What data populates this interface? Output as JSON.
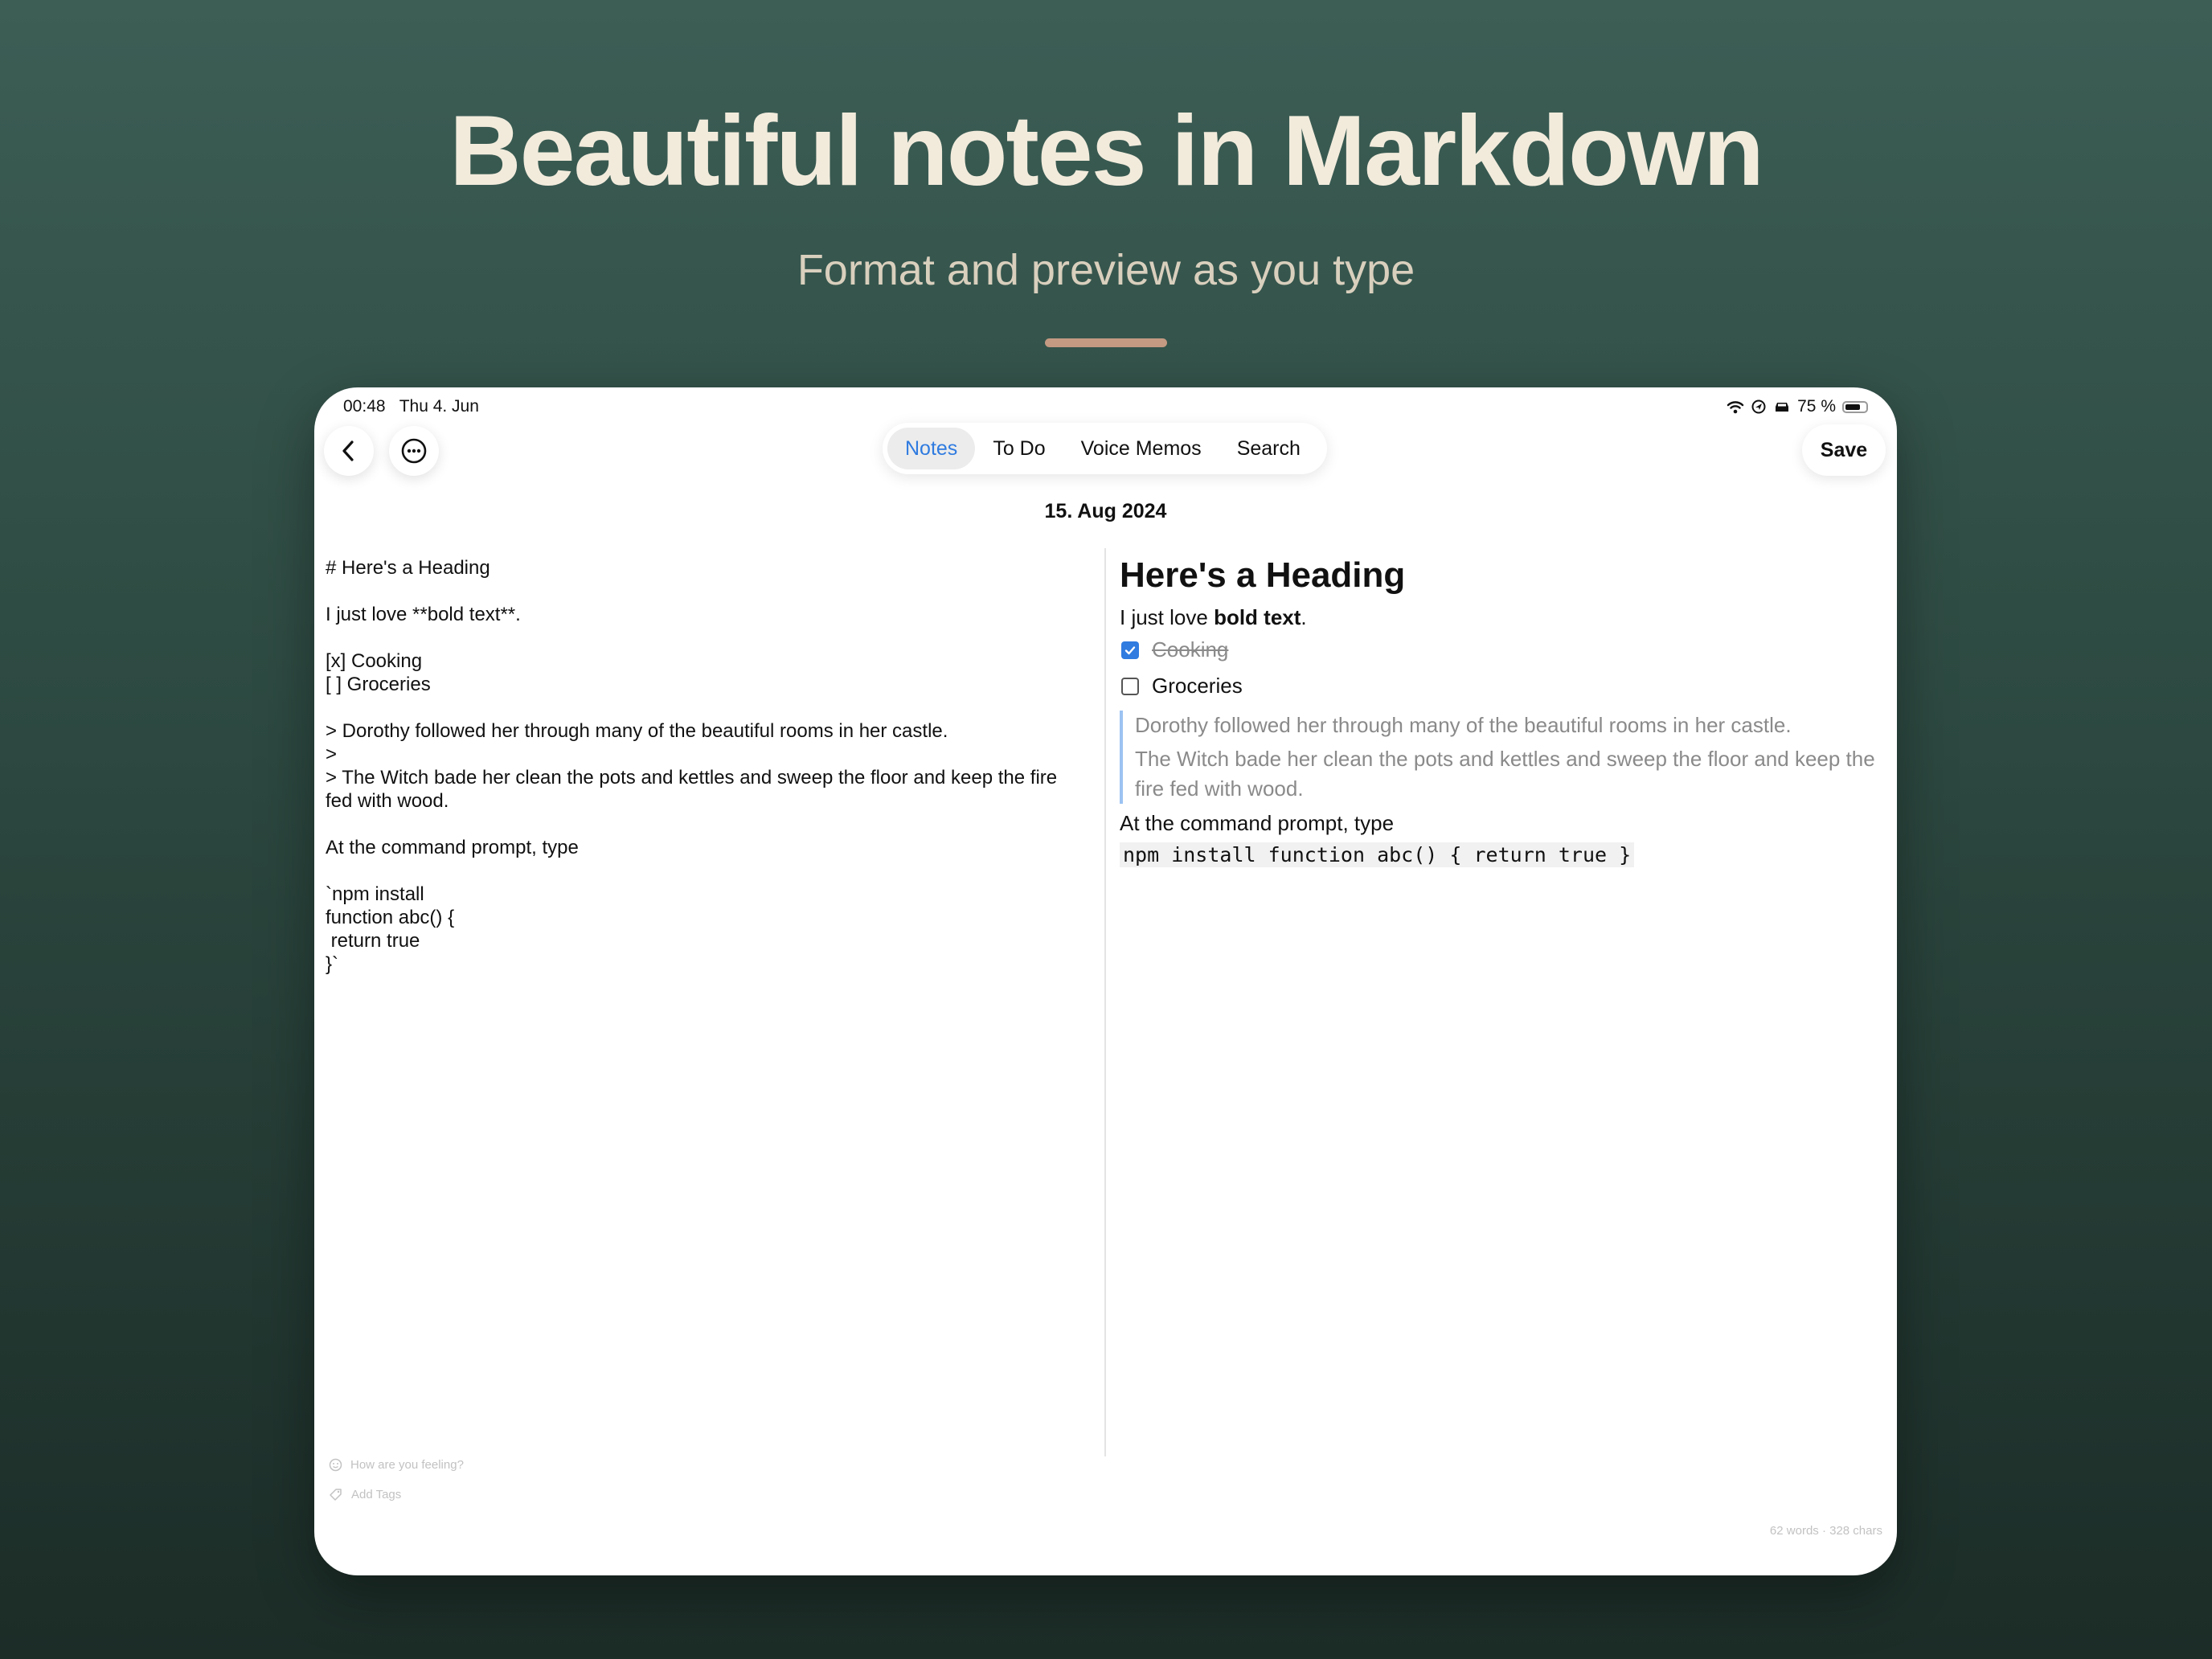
{
  "promo": {
    "headline": "Beautiful notes in Markdown",
    "subheadline": "Format and preview as you type"
  },
  "status_bar": {
    "time": "00:48",
    "date": "Thu 4. Jun",
    "battery": "75 %",
    "battery_level": 0.75
  },
  "toolbar": {
    "tabs": [
      {
        "label": "Notes",
        "active": true
      },
      {
        "label": "To Do",
        "active": false
      },
      {
        "label": "Voice Memos",
        "active": false
      },
      {
        "label": "Search",
        "active": false
      }
    ],
    "save_label": "Save"
  },
  "note": {
    "date": "15. Aug 2024",
    "source_lines": [
      "# Here's a Heading",
      "",
      "I just love **bold text**.",
      "",
      "[x] Cooking",
      "[ ] Groceries",
      "",
      "> Dorothy followed her through many of the beautiful rooms in her castle.",
      ">",
      "> The Witch bade her clean the pots and kettles and sweep the floor and keep the fire",
      "fed with wood.",
      "",
      "At the command prompt, type",
      "",
      "`npm install",
      "function abc() {",
      " return true",
      "}`"
    ],
    "preview": {
      "heading": "Here's a Heading",
      "para_prefix": "I just love ",
      "para_bold": "bold text",
      "para_suffix": ".",
      "tasks": [
        {
          "label": "Cooking",
          "done": true
        },
        {
          "label": "Groceries",
          "done": false
        }
      ],
      "quote_lines": [
        "Dorothy followed her through many of the beautiful rooms in her castle.",
        "The Witch bade her clean the pots and kettles and sweep the floor and keep the fire fed with wood."
      ],
      "command_text": "At the command prompt, type",
      "code": "npm install function abc() { return true }"
    }
  },
  "footer": {
    "mood_placeholder": "How are you feeling?",
    "tags_placeholder": "Add Tags",
    "counter": "62 words · 328 chars"
  },
  "icons": [
    "back-chevron-icon",
    "more-options-icon",
    "wifi-icon",
    "location-icon",
    "car-icon",
    "battery-icon",
    "smiley-icon",
    "tag-icon"
  ],
  "colors": {
    "accent_blue": "#2f7be0",
    "headline": "#f2ebdc",
    "accent_bar": "#c49a82",
    "quote_border": "#9cc3f2"
  }
}
